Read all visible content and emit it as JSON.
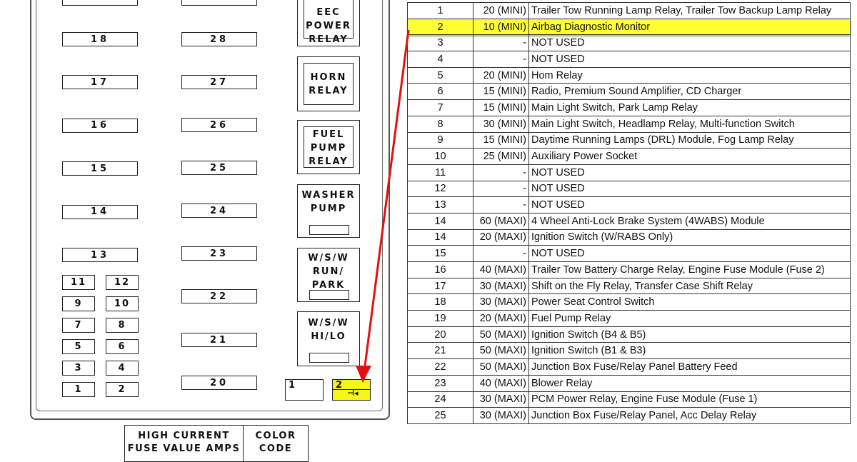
{
  "diagram": {
    "long_fuses_left": [
      "18",
      "17",
      "16",
      "15",
      "14",
      "13"
    ],
    "long_fuses_right": [
      "28",
      "27",
      "26",
      "25",
      "24",
      "23",
      "22",
      "21",
      "20"
    ],
    "small_fuses": [
      [
        "11",
        "12"
      ],
      [
        "9",
        "10"
      ],
      [
        "7",
        "8"
      ],
      [
        "5",
        "6"
      ],
      [
        "3",
        "4"
      ],
      [
        "1",
        "2"
      ]
    ],
    "relays": [
      {
        "label": "EEC\nPOWER\nRELAY"
      },
      {
        "label": "HORN\nRELAY"
      },
      {
        "label": "FUEL\nPUMP\nRELAY"
      },
      {
        "label": "WASHER\nPUMP"
      },
      {
        "label": "W/S/W\nRUN/\nPARK"
      },
      {
        "label": "W/S/W\nHI/LO"
      }
    ],
    "maxi_slots": [
      {
        "label": "1",
        "highlighted": false
      },
      {
        "label": "2",
        "highlighted": true
      }
    ],
    "legend": {
      "col1": "HIGH CURRENT\nFUSE VALUE AMPS",
      "col2": "COLOR\nCODE"
    },
    "highlight_color": "#f5f51a",
    "arrow_color": "#e01010"
  },
  "table": {
    "rows": [
      {
        "num": "1",
        "amps": "20 (MINI)",
        "desc": "Trailer Tow Running Lamp Relay, Trailer Tow Backup Lamp Relay",
        "highlighted": false
      },
      {
        "num": "2",
        "amps": "10 (MINI)",
        "desc": "Airbag Diagnostic Monitor",
        "highlighted": true
      },
      {
        "num": "3",
        "amps": "-",
        "desc": "NOT USED",
        "highlighted": false
      },
      {
        "num": "4",
        "amps": "-",
        "desc": "NOT USED",
        "highlighted": false
      },
      {
        "num": "5",
        "amps": "20 (MINI)",
        "desc": "Hom Relay",
        "highlighted": false
      },
      {
        "num": "6",
        "amps": "15 (MINI)",
        "desc": "Radio, Premium Sound Amplifier, CD Charger",
        "highlighted": false
      },
      {
        "num": "7",
        "amps": "15 (MINI)",
        "desc": "Main Light Switch, Park Lamp Relay",
        "highlighted": false
      },
      {
        "num": "8",
        "amps": "30 (MINI)",
        "desc": "Main Light Switch, Headlamp Relay, Multi-function Switch",
        "highlighted": false
      },
      {
        "num": "9",
        "amps": "15 (MINI)",
        "desc": "Daytime Running Lamps (DRL) Module, Fog Lamp Relay",
        "highlighted": false
      },
      {
        "num": "10",
        "amps": "25 (MINI)",
        "desc": "Auxiliary Power Socket",
        "highlighted": false
      },
      {
        "num": "11",
        "amps": "-",
        "desc": "NOT USED",
        "highlighted": false
      },
      {
        "num": "12",
        "amps": "-",
        "desc": "NOT USED",
        "highlighted": false
      },
      {
        "num": "13",
        "amps": "-",
        "desc": "NOT USED",
        "highlighted": false
      },
      {
        "num": "14",
        "amps": "60 (MAXI)",
        "desc": "4 Wheel Anti-Lock Brake System (4WABS) Module",
        "highlighted": false
      },
      {
        "num": "14",
        "amps": "20 (MAXI)",
        "desc": "Ignition Switch (W/RABS Only)",
        "highlighted": false
      },
      {
        "num": "15",
        "amps": "-",
        "desc": "NOT USED",
        "highlighted": false
      },
      {
        "num": "16",
        "amps": "40 (MAXI)",
        "desc": "Trailer Tow Battery Charge Relay, Engine Fuse Module (Fuse 2)",
        "highlighted": false
      },
      {
        "num": "17",
        "amps": "30 (MAXI)",
        "desc": "Shift on the Fly Relay, Transfer Case Shift Relay",
        "highlighted": false
      },
      {
        "num": "18",
        "amps": "30 (MAXI)",
        "desc": "Power Seat Control Switch",
        "highlighted": false
      },
      {
        "num": "19",
        "amps": "20 (MAXI)",
        "desc": "Fuel Pump Relay",
        "highlighted": false
      },
      {
        "num": "20",
        "amps": "50 (MAXI)",
        "desc": "Ignition Switch (B4 & B5)",
        "highlighted": false
      },
      {
        "num": "21",
        "amps": "50 (MAXI)",
        "desc": "Ignition Switch (B1 & B3)",
        "highlighted": false
      },
      {
        "num": "22",
        "amps": "50 (MAXI)",
        "desc": "Junction Box Fuse/Relay Panel Battery Feed",
        "highlighted": false
      },
      {
        "num": "23",
        "amps": "40 (MAXI)",
        "desc": "Blower  Relay",
        "highlighted": false
      },
      {
        "num": "24",
        "amps": "30 (MAXI)",
        "desc": "PCM Power Relay, Engine Fuse Module (Fuse 1)",
        "highlighted": false
      },
      {
        "num": "25",
        "amps": "30 (MAXI)",
        "desc": "Junction Box Fuse/Relay Panel, Acc Delay Relay",
        "highlighted": false
      }
    ]
  }
}
